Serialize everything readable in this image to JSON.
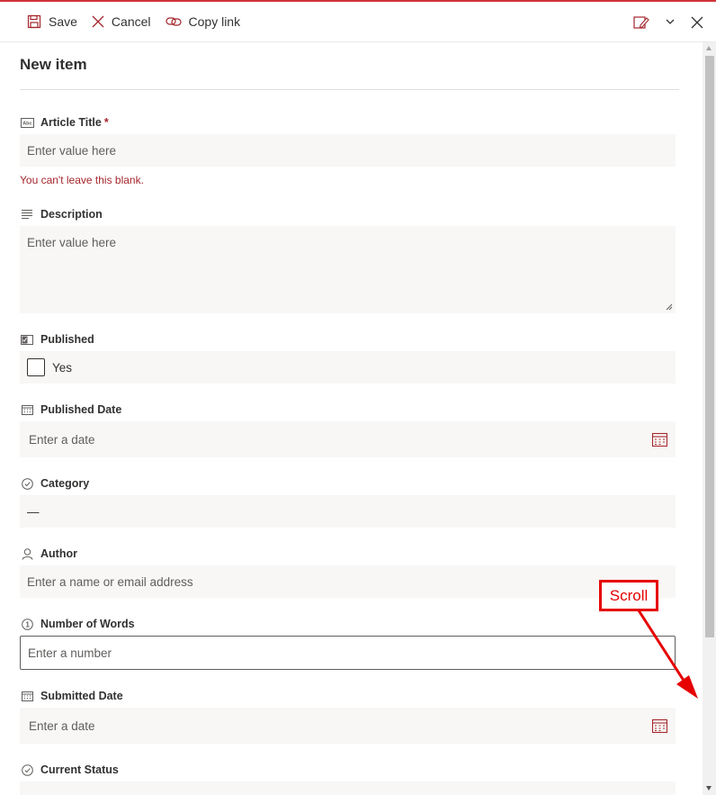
{
  "toolbar": {
    "save_label": "Save",
    "cancel_label": "Cancel",
    "copy_link_label": "Copy link"
  },
  "form": {
    "title": "New item",
    "article_title": {
      "label": "Article Title",
      "required_mark": "*",
      "placeholder": "Enter value here",
      "error": "You can't leave this blank."
    },
    "description": {
      "label": "Description",
      "placeholder": "Enter value here"
    },
    "published": {
      "label": "Published",
      "checkbox_label": "Yes"
    },
    "published_date": {
      "label": "Published Date",
      "placeholder": "Enter a date"
    },
    "category": {
      "label": "Category",
      "value": "—"
    },
    "author": {
      "label": "Author",
      "placeholder": "Enter a name or email address"
    },
    "number_of_words": {
      "label": "Number of Words",
      "placeholder": "Enter a number"
    },
    "submitted_date": {
      "label": "Submitted Date",
      "placeholder": "Enter a date"
    },
    "current_status": {
      "label": "Current Status"
    }
  },
  "annotation": {
    "text": "Scroll",
    "color": "#e60000"
  },
  "colors": {
    "accent": "#a4262c",
    "field_bg": "#f8f7f5",
    "top_line": "#d13438"
  },
  "icons": [
    "save-icon",
    "cancel-icon",
    "copy-link-icon",
    "edit-form-icon",
    "chevron-down-icon",
    "close-icon",
    "text-field-icon",
    "description-icon",
    "boolean-icon",
    "calendar-icon",
    "choice-icon",
    "person-icon",
    "number-icon"
  ]
}
